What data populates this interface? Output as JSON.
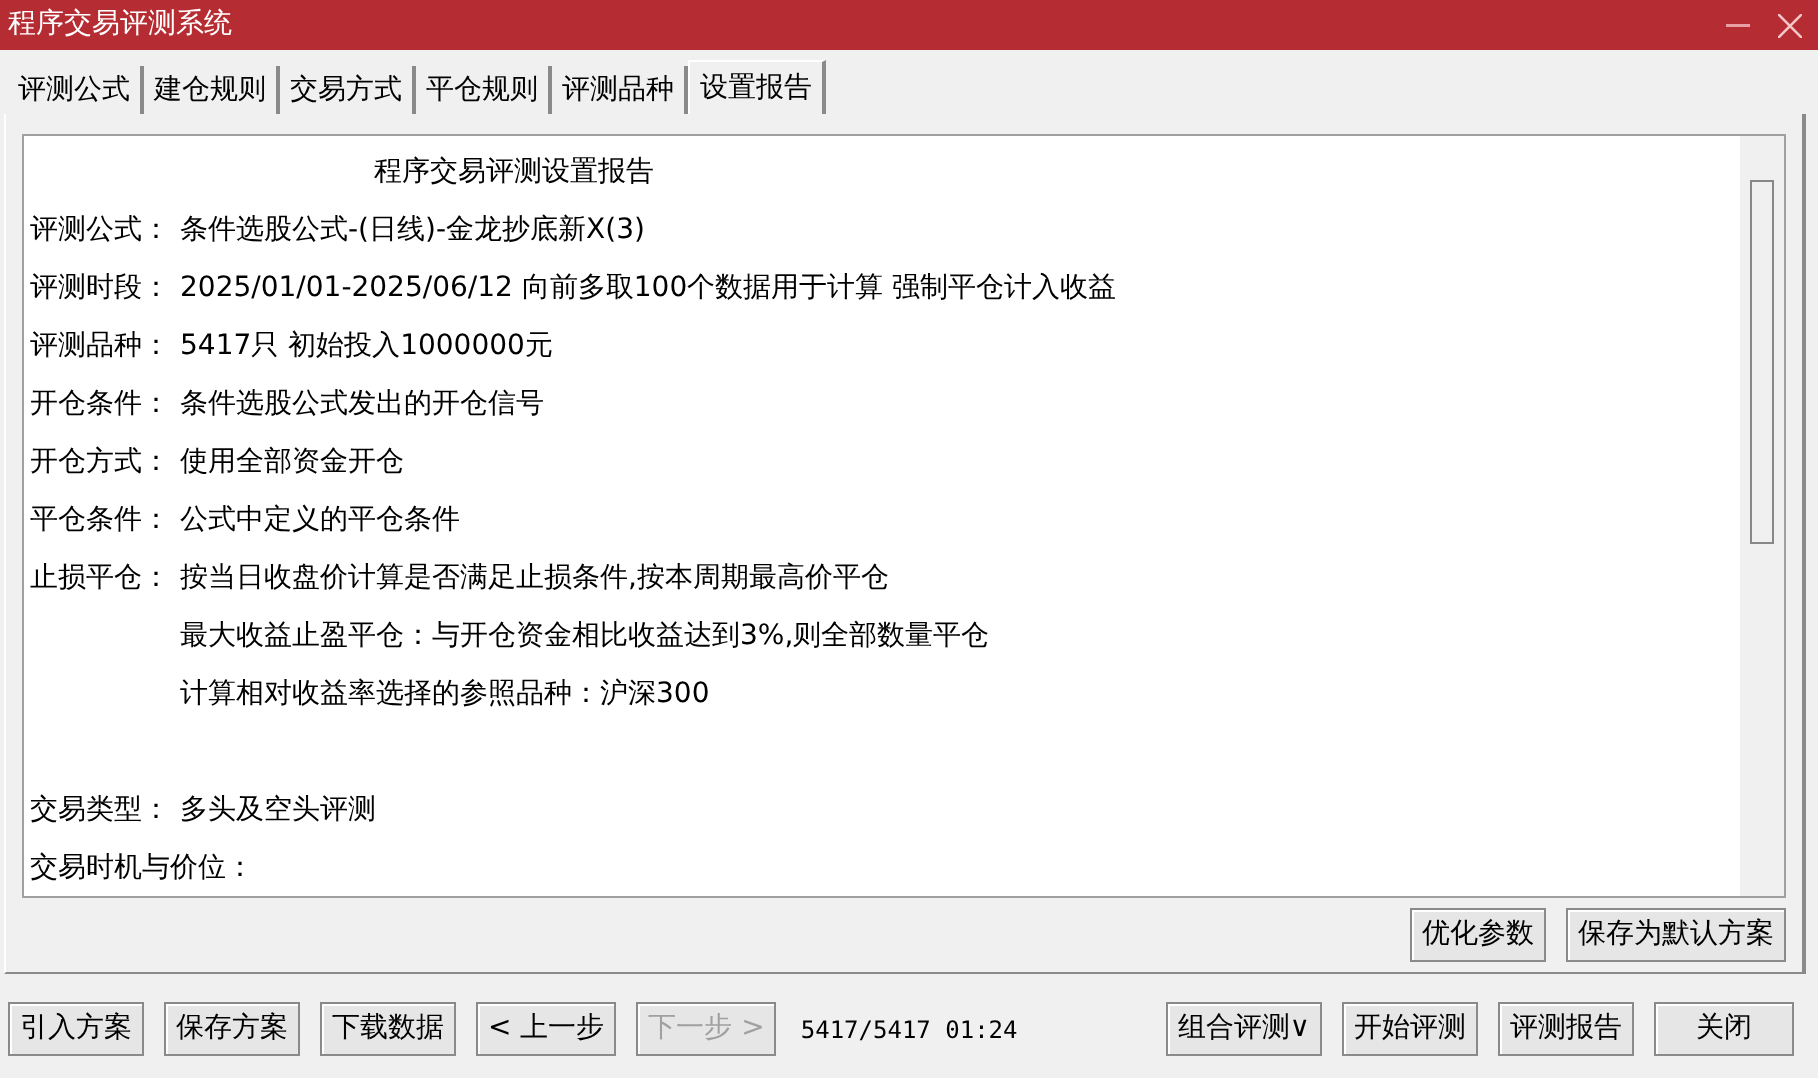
{
  "window": {
    "title": "程序交易评测系统"
  },
  "tabs": [
    {
      "label": "评测公式",
      "selected": false
    },
    {
      "label": "建仓规则",
      "selected": false
    },
    {
      "label": "交易方式",
      "selected": false
    },
    {
      "label": "平仓规则",
      "selected": false
    },
    {
      "label": "评测品种",
      "selected": false
    },
    {
      "label": "设置报告",
      "selected": true
    }
  ],
  "report": {
    "title": "程序交易评测设置报告",
    "sections": [
      [
        {
          "label": "评测公式：",
          "value": "条件选股公式-(日线)-金龙抄底新X(3)"
        },
        {
          "label": "评测时段：",
          "value": "2025/01/01-2025/06/12 向前多取100个数据用于计算 强制平仓计入收益"
        },
        {
          "label": "评测品种：",
          "value": "5417只 初始投入1000000元"
        },
        {
          "label": "开仓条件：",
          "value": "条件选股公式发出的开仓信号"
        },
        {
          "label": "开仓方式：",
          "value": "使用全部资金开仓"
        },
        {
          "label": "平仓条件：",
          "value": "公式中定义的平仓条件"
        },
        {
          "label": "止损平仓：",
          "value": "按当日收盘价计算是否满足止损条件,按本周期最高价平仓"
        },
        {
          "value": "最大收益止盈平仓：与开仓资金相比收益达到3%,则全部数量平仓"
        },
        {
          "value": "计算相对收益率选择的参照品种：沪深300"
        }
      ],
      [
        {
          "label": "交易类型：",
          "value": "多头及空头评测"
        },
        {
          "label": "交易时机与价位："
        }
      ]
    ]
  },
  "panel_buttons": [
    {
      "label": "优化参数",
      "disabled": false
    },
    {
      "label": "保存为默认方案",
      "disabled": false
    }
  ],
  "footer_buttons_left": [
    {
      "label": "引入方案",
      "disabled": false
    },
    {
      "label": "保存方案",
      "disabled": false
    },
    {
      "label": "下载数据",
      "disabled": false
    },
    {
      "label": "< 上一步",
      "disabled": false
    },
    {
      "label": "下一步 >",
      "disabled": true
    }
  ],
  "status": "5417/5417 01:24",
  "footer_buttons_right": [
    {
      "label": "组合评测∨",
      "disabled": false
    },
    {
      "label": "开始评测",
      "disabled": false
    },
    {
      "label": "评测报告",
      "disabled": false
    },
    {
      "label": "关闭",
      "disabled": false
    }
  ]
}
